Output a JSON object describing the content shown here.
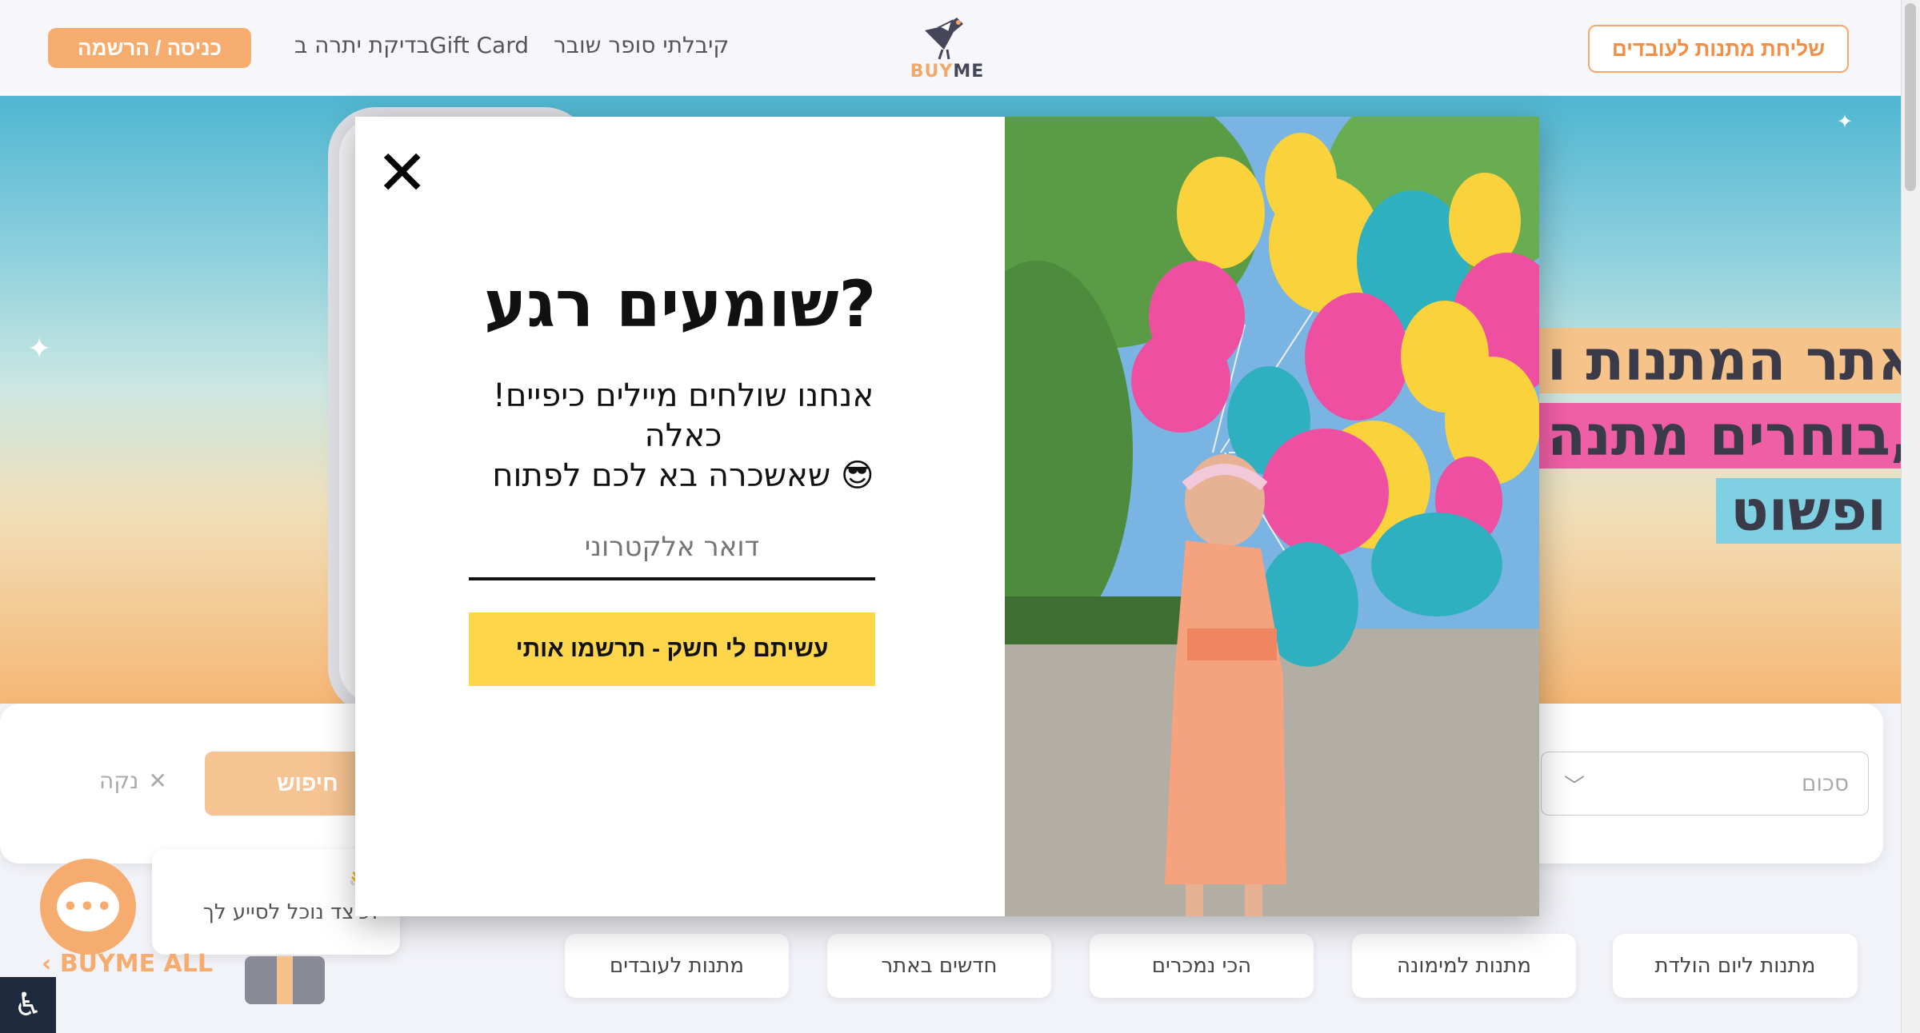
{
  "header": {
    "login_label": "כניסה / הרשמה",
    "nav_giftcard": "בדיקת יתרה בGift Card",
    "nav_broken": "קיבלתי סופר שובר",
    "logo_text_buy": "BUY",
    "logo_text_me": "ME",
    "employees_label": "שליחת מתנות לעובדים"
  },
  "hero": {
    "lines": [
      "אתר המתנות ו",
      "בוחרים מתנה,",
      "ופשוט"
    ]
  },
  "search": {
    "clear_label": "נקה",
    "search_label": "חיפוש",
    "amount_label": "סכום"
  },
  "categories": [
    "מתנות ליום הולדת",
    "מתנות למימונה",
    "הכי נמכרים",
    "חדשים באתר",
    "מתנות לעובדים"
  ],
  "chat": {
    "button_glyph": "•••",
    "wave": "👋,",
    "question": "כיצד נוכל לסייע לך?",
    "buyme_all": "BUYME ALL"
  },
  "modal": {
    "close_glyph": "✕",
    "title": "שומעים רגע?",
    "subtitle_line1": "אנחנו שולחים מיילים כיפיים! כאלה",
    "subtitle_line2": "שאשכרה בא לכם לפתוח 😎",
    "email_placeholder": "דואר אלקטרוני",
    "submit_label": "עשיתם לי חשק - תרשמו אותי",
    "image_alt": "girl with balloons"
  },
  "accessibility": {
    "glyph": "♿"
  },
  "colors": {
    "accent": "#f6ac6f",
    "submit": "#fdd64b",
    "pink": "#ef5fa6",
    "teal": "#2fb0c0",
    "yellow": "#f9d23c"
  }
}
